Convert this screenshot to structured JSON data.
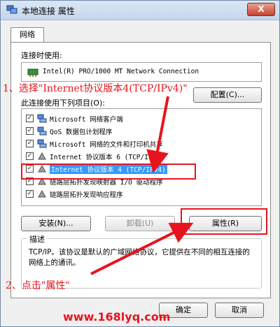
{
  "window": {
    "title": "本地连接 属性",
    "close_label": "X"
  },
  "tabs": [
    {
      "label": "网络"
    }
  ],
  "connect_using": {
    "label": "连接时使用:",
    "adapter": "Intel(R) PRO/1000 MT Network Connection",
    "configure_label": "配置(C)..."
  },
  "items_label": "此连接使用下列项目(O):",
  "items": [
    {
      "label": "Microsoft 网络客户端",
      "checked": true,
      "icon": "network-client-icon"
    },
    {
      "label": "QoS 数据包计划程序",
      "checked": true,
      "icon": "qos-icon"
    },
    {
      "label": "Microsoft 网络的文件和打印机共享",
      "checked": true,
      "icon": "file-share-icon"
    },
    {
      "label": "Internet 协议版本 6 (TCP/IPv6)",
      "checked": true,
      "icon": "protocol-icon"
    },
    {
      "label": "Internet 协议版本 4 (TCP/IPv4)",
      "checked": true,
      "icon": "protocol-icon",
      "selected": true
    },
    {
      "label": "链路层拓扑发现映射器 I/O 驱动程序",
      "checked": true,
      "icon": "protocol-icon"
    },
    {
      "label": "链路层拓扑发现响应程序",
      "checked": true,
      "icon": "protocol-icon"
    }
  ],
  "buttons": {
    "install": "安装(N)...",
    "uninstall": "卸载(U)",
    "properties": "属性(R)",
    "ok": "确定",
    "cancel": "取消"
  },
  "description": {
    "title": "描述",
    "text": "TCP/IP。该协议是默认的广域网络协议，它提供在不同的相互连接的网络上的通讯。"
  },
  "annotations": {
    "step1": "1、选择\"Internet协议版本4(TCP/IPv4)\"",
    "step2": "2、点击\"属性\"",
    "color": "#e8141d"
  },
  "watermark": "www.168lyq.com",
  "colors": {
    "selection": "#3399ff",
    "title_bar": "#c4d6ec"
  }
}
